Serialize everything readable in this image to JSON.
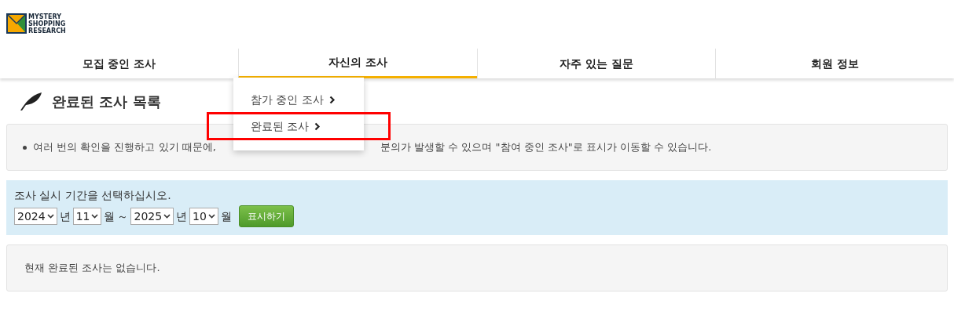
{
  "logo": {
    "lines": [
      "MYSTERY",
      "SHOPPING",
      "RESEARCH"
    ]
  },
  "nav": [
    {
      "label": "모집 중인 조사",
      "selected": false
    },
    {
      "label": "자신의 조사",
      "selected": true
    },
    {
      "label": "자주 있는 질문",
      "selected": false
    },
    {
      "label": "회원 정보",
      "selected": false
    }
  ],
  "dropdown": [
    {
      "label": "참가 중인 조사",
      "highlighted": false
    },
    {
      "label": "완료된 조사",
      "highlighted": true
    }
  ],
  "heading": "완료된 조사 목록",
  "notice": {
    "text_before": "여러 번의 확인을 진행하고 있기 때문에,",
    "text_after": "분의가 발생할 수 있으며 \"참여 중인 조사\"로 표시가 이동할 수 있습니다."
  },
  "filter": {
    "prompt": "조사 실시 기간을 선택하십시오.",
    "from_year": "2024",
    "year_unit_1": "년",
    "from_month": "11",
    "month_unit_1": "월",
    "separator": "～",
    "to_year": "2025",
    "year_unit_2": "년",
    "to_month": "10",
    "month_unit_2": "월",
    "button": "표시하기"
  },
  "empty_message": "현재 완료된 조사는 없습니다."
}
